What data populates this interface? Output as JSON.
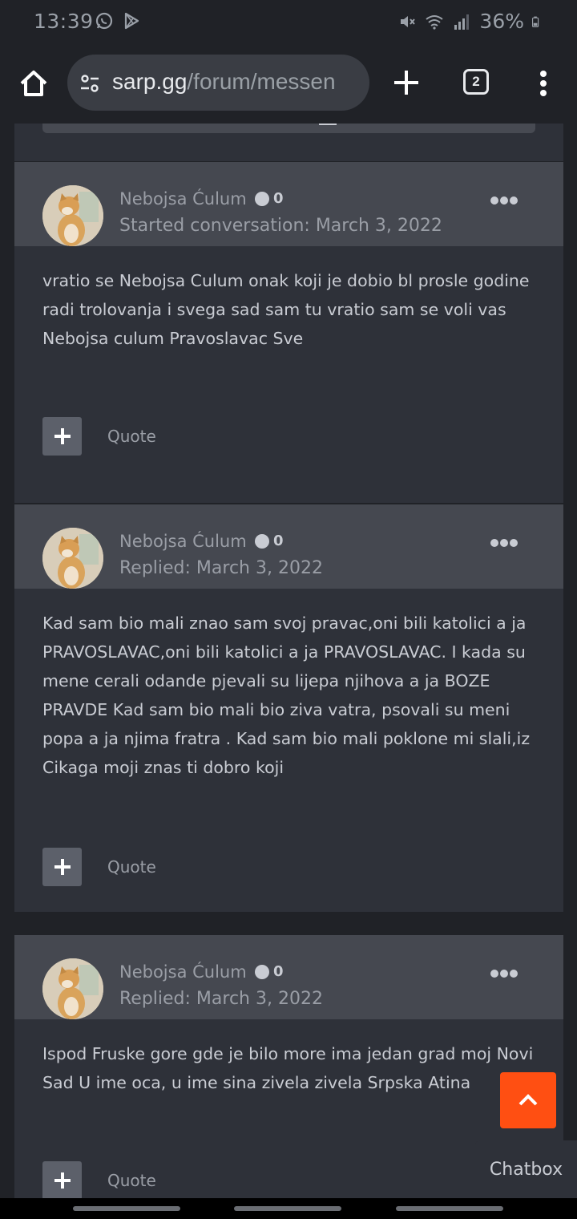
{
  "status_bar": {
    "time": "13:39",
    "battery": "36%",
    "icons": [
      "whatsapp-icon",
      "play-store-icon",
      "mute-icon",
      "wifi-icon",
      "signal-icon",
      "battery-icon"
    ]
  },
  "browser": {
    "url_host": "sarp.gg",
    "url_path": "/forum/messen",
    "tab_count": "2"
  },
  "posts": [
    {
      "author": "Nebojsa Ćulum",
      "reputation": "0",
      "meta": "Started conversation: March 3, 2022",
      "body": "vratio se Nebojsa Culum onak koji je dobio bl prosle godine radi trolovanja i svega sad sam tu vratio sam se voli vas Nebojsa culum Pravoslavac Sve",
      "quote_label": "Quote"
    },
    {
      "author": "Nebojsa Ćulum",
      "reputation": "0",
      "meta": "Replied: March 3, 2022",
      "body": "Kad sam bio mali znao sam svoj pravac,oni bili katolici a ja PRAVOSLAVAC,oni bili katolici a ja PRAVOSLAVAC. I kada su mene cerali odande pjevali su lijepa njihova a ja BOZE PRAVDE  Kad sam bio mali bio ziva vatra, psovali su meni popa a ja njima fratra  . Kad sam bio mali poklone mi slali,iz Cikaga moji znas ti dobro koji",
      "quote_label": "Quote"
    },
    {
      "author": "Nebojsa Ćulum",
      "reputation": "0",
      "meta": "Replied: March 3, 2022",
      "body": "Ispod Fruske gore gde je bilo more ima jedan grad moj Novi Sad U ime oca, u ime sina zivela zivela Srpska Atina",
      "quote_label": "Quote"
    }
  ],
  "chatbox_label": "Chatbox",
  "colors": {
    "background": "#202227",
    "post_background": "#2e3139",
    "post_header": "#454850",
    "accent": "#ff4f12"
  }
}
